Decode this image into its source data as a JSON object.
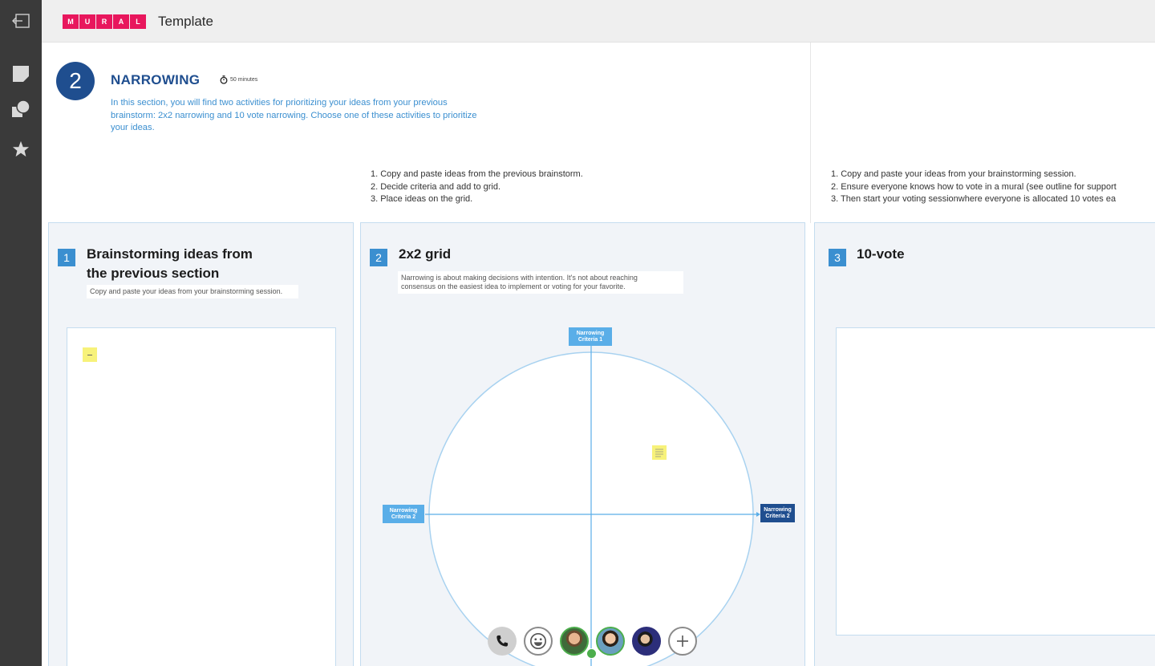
{
  "app": {
    "logo_letters": [
      "M",
      "U",
      "R",
      "A",
      "L"
    ],
    "title": "Template",
    "brand_color": "#e8175d"
  },
  "sidebar": {
    "exit_icon": "exit-icon",
    "tools": [
      "sticky-note-icon",
      "shapes-icon",
      "star-icon"
    ]
  },
  "section": {
    "number": "2",
    "title": "NARROWING",
    "timer": "50 minutes",
    "description": "In this section, you will find two activities for prioritizing your ideas from your previous brainstorm: 2x2 narrowing and 10 vote narrowing. Choose one of these activities to prioritize your ideas."
  },
  "steps_grid": [
    "1. Copy and paste ideas from the previous brainstorm.",
    "2. Decide criteria and add to grid.",
    "3. Place ideas on the grid."
  ],
  "steps_vote": [
    "1. Copy and paste your ideas from your brainstorming session.",
    "2. Ensure everyone knows how to vote in a mural (see outline for support",
    "3. Then start your voting sessionwhere everyone is allocated 10 votes ea"
  ],
  "panels": [
    {
      "number": "1",
      "title_line1": "Brainstorming ideas from",
      "title_line2": "the previous section",
      "note": "Copy and paste your ideas from your brainstorming session."
    },
    {
      "number": "2",
      "title": "2x2 grid",
      "note_line1": "Narrowing is about making decisions with intention. It's not about reaching",
      "note_line2": "consensus on the easiest idea to implement or voting for your favorite.",
      "criteria_top_1": "Narrowing",
      "criteria_top_2": "Criteria 1",
      "criteria_left_1": "Narrowing",
      "criteria_left_2": "Criteria 2",
      "criteria_right_1": "Narrowing",
      "criteria_right_2": "Criteria 2"
    },
    {
      "number": "3",
      "title": "10-vote"
    }
  ],
  "toolbar": {
    "buttons": [
      "phone-icon",
      "emoji-icon",
      "avatar",
      "avatar",
      "avatar",
      "add-icon"
    ]
  },
  "colors": {
    "sidebar": "#3a3a3a",
    "section_blue": "#1f4e8f",
    "accent_blue": "#3b8fd0",
    "sticky_yellow": "#f7f27a"
  }
}
